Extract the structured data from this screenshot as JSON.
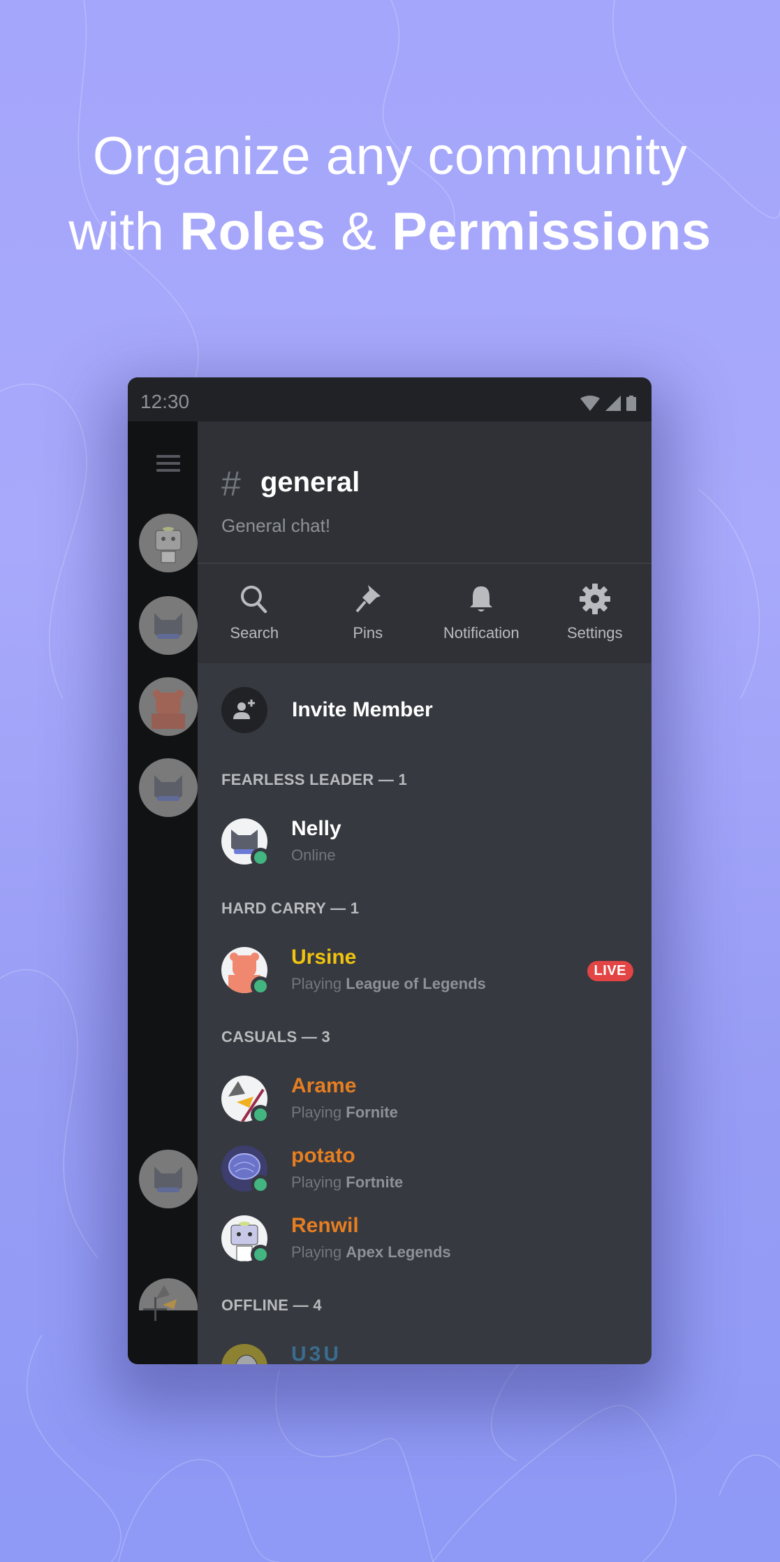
{
  "headline": {
    "line1": "Organize any community",
    "line2_prefix": "with ",
    "line2_bold1": "Roles",
    "line2_amp": " & ",
    "line2_bold2": "Permissions"
  },
  "statusbar": {
    "time": "12:30",
    "icons": [
      "wifi-icon",
      "signal-icon",
      "battery-icon"
    ]
  },
  "rail": {
    "menu_icon": "hamburger-menu-icon",
    "servers": [
      "robot-server",
      "cat-server",
      "bear-server",
      "cat-server-2",
      "cat-server-3",
      "duck-server"
    ],
    "add_icon": "plus-icon"
  },
  "channel": {
    "hash": "#",
    "name": "general",
    "topic": "General chat!"
  },
  "toolbar": {
    "items": [
      {
        "label": "Search",
        "icon": "search-icon"
      },
      {
        "label": "Pins",
        "icon": "pin-icon"
      },
      {
        "label": "Notification",
        "icon": "bell-icon"
      },
      {
        "label": "Settings",
        "icon": "gear-icon"
      }
    ]
  },
  "invite": {
    "label": "Invite Member",
    "icon": "add-user-icon"
  },
  "sections": [
    {
      "title": "FEARLESS LEADER — 1"
    },
    {
      "title": "HARD CARRY — 1"
    },
    {
      "title": "CASUALS — 3"
    },
    {
      "title": "OFFLINE — 4"
    }
  ],
  "members": [
    {
      "name": "Nelly",
      "color": "#ffffff",
      "status_text": "Online",
      "activity_prefix": "",
      "activity": "",
      "online": true,
      "live": false
    },
    {
      "name": "Ursine",
      "color": "#f1c40f",
      "status_text": "",
      "activity_prefix": "Playing ",
      "activity": "League of Legends",
      "online": true,
      "live": true,
      "live_label": "LIVE"
    },
    {
      "name": "Arame",
      "color": "#e67e22",
      "status_text": "",
      "activity_prefix": "Playing ",
      "activity": "Fornite",
      "online": true,
      "live": false
    },
    {
      "name": "potato",
      "color": "#e67e22",
      "status_text": "",
      "activity_prefix": "Playing ",
      "activity": "Fortnite",
      "online": true,
      "live": false
    },
    {
      "name": "Renwil",
      "color": "#e67e22",
      "status_text": "",
      "activity_prefix": "Playing ",
      "activity": "Apex Legends",
      "online": true,
      "live": false
    },
    {
      "name": "U3U",
      "color": "#3e6d8e",
      "status_text": "",
      "activity_prefix": "",
      "activity": "",
      "online": false,
      "live": false
    }
  ],
  "colors": {
    "online": "#43b581",
    "live": "#e34444",
    "background": "#36393f",
    "rail": "#111214"
  }
}
